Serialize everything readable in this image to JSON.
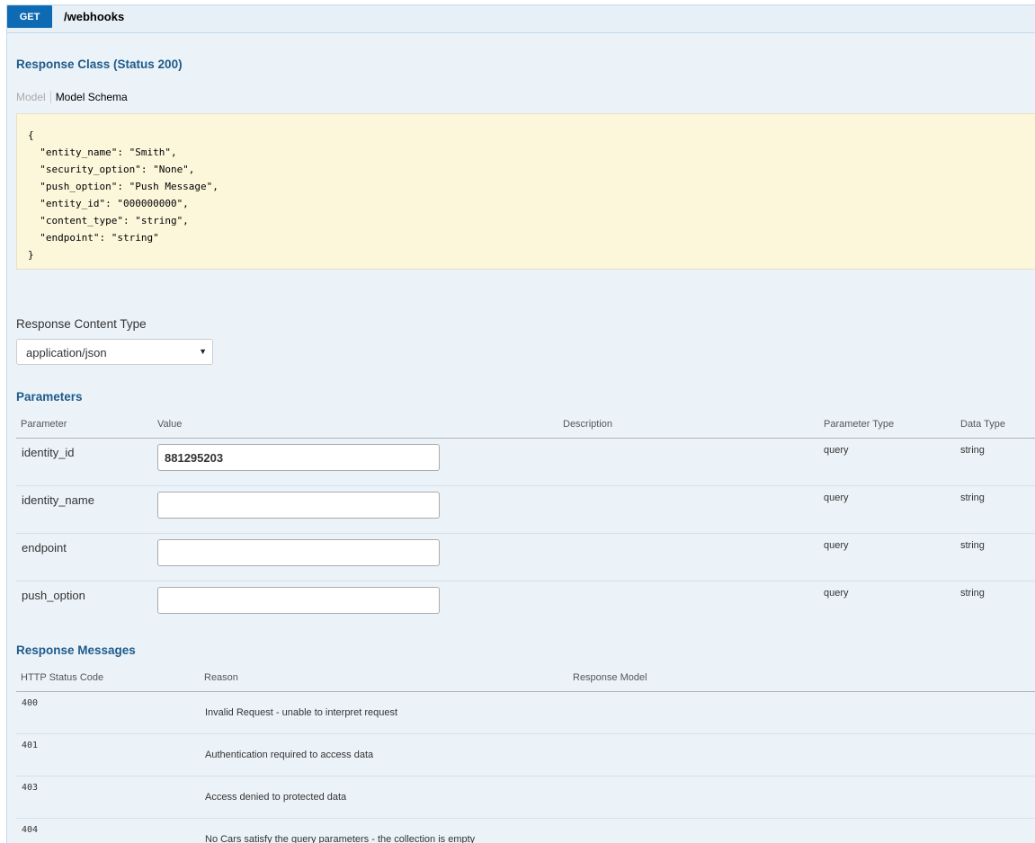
{
  "operation": {
    "method": "GET",
    "path": "/webhooks"
  },
  "response_class": {
    "title": "Response Class (Status 200)",
    "tabs": {
      "model": "Model",
      "schema": "Model Schema"
    },
    "schema_text": "{\n  \"entity_name\": \"Smith\",\n  \"security_option\": \"None\",\n  \"push_option\": \"Push Message\",\n  \"entity_id\": \"000000000\",\n  \"content_type\": \"string\",\n  \"endpoint\": \"string\"\n}"
  },
  "content_type": {
    "label": "Response Content Type",
    "selected": "application/json"
  },
  "parameters": {
    "title": "Parameters",
    "headers": {
      "parameter": "Parameter",
      "value": "Value",
      "description": "Description",
      "param_type": "Parameter Type",
      "data_type": "Data Type"
    },
    "rows": [
      {
        "name": "identity_id",
        "value": "881295203",
        "param_type": "query",
        "data_type": "string"
      },
      {
        "name": "identity_name",
        "value": "",
        "param_type": "query",
        "data_type": "string"
      },
      {
        "name": "endpoint",
        "value": "",
        "param_type": "query",
        "data_type": "string"
      },
      {
        "name": "push_option",
        "value": "",
        "param_type": "query",
        "data_type": "string"
      }
    ]
  },
  "response_messages": {
    "title": "Response Messages",
    "headers": {
      "code": "HTTP Status Code",
      "reason": "Reason",
      "model": "Response Model"
    },
    "rows": [
      {
        "code": "400",
        "reason": "Invalid Request - unable to interpret request"
      },
      {
        "code": "401",
        "reason": "Authentication required to access data"
      },
      {
        "code": "403",
        "reason": "Access denied to protected data"
      },
      {
        "code": "404",
        "reason": "No Cars satisfy the query parameters - the collection is empty"
      }
    ]
  }
}
